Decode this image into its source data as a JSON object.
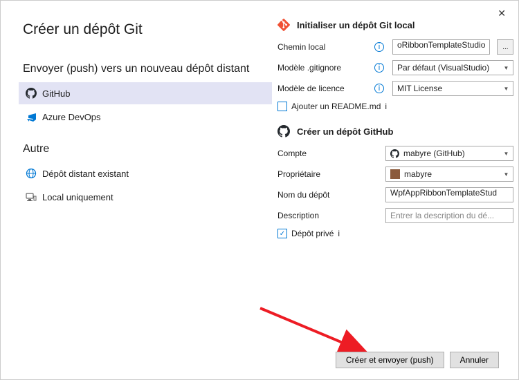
{
  "window": {
    "title": "Créer un dépôt Git"
  },
  "left": {
    "push_section": "Envoyer (push) vers un nouveau dépôt distant",
    "github": "GitHub",
    "azure": "Azure DevOps",
    "other_section": "Autre",
    "existing_remote": "Dépôt distant existant",
    "local_only": "Local uniquement"
  },
  "right": {
    "init_title": "Initialiser un dépôt Git local",
    "local_path_label": "Chemin local",
    "local_path_value": "oRibbonTemplateStudio",
    "gitignore_label": "Modèle .gitignore",
    "gitignore_value": "Par défaut (VisualStudio)",
    "license_label": "Modèle de licence",
    "license_value": "MIT License",
    "add_readme": "Ajouter un README.md",
    "create_title": "Créer un dépôt GitHub",
    "account_label": "Compte",
    "account_value": "mabyre (GitHub)",
    "owner_label": "Propriétaire",
    "owner_value": "mabyre",
    "repo_name_label": "Nom du dépôt",
    "repo_name_value": "WpfAppRibbonTemplateStud",
    "description_label": "Description",
    "description_placeholder": "Entrer la description du dé...",
    "private_repo": "Dépôt privé"
  },
  "footer": {
    "create_push": "Créer et envoyer (push)",
    "cancel": "Annuler"
  }
}
